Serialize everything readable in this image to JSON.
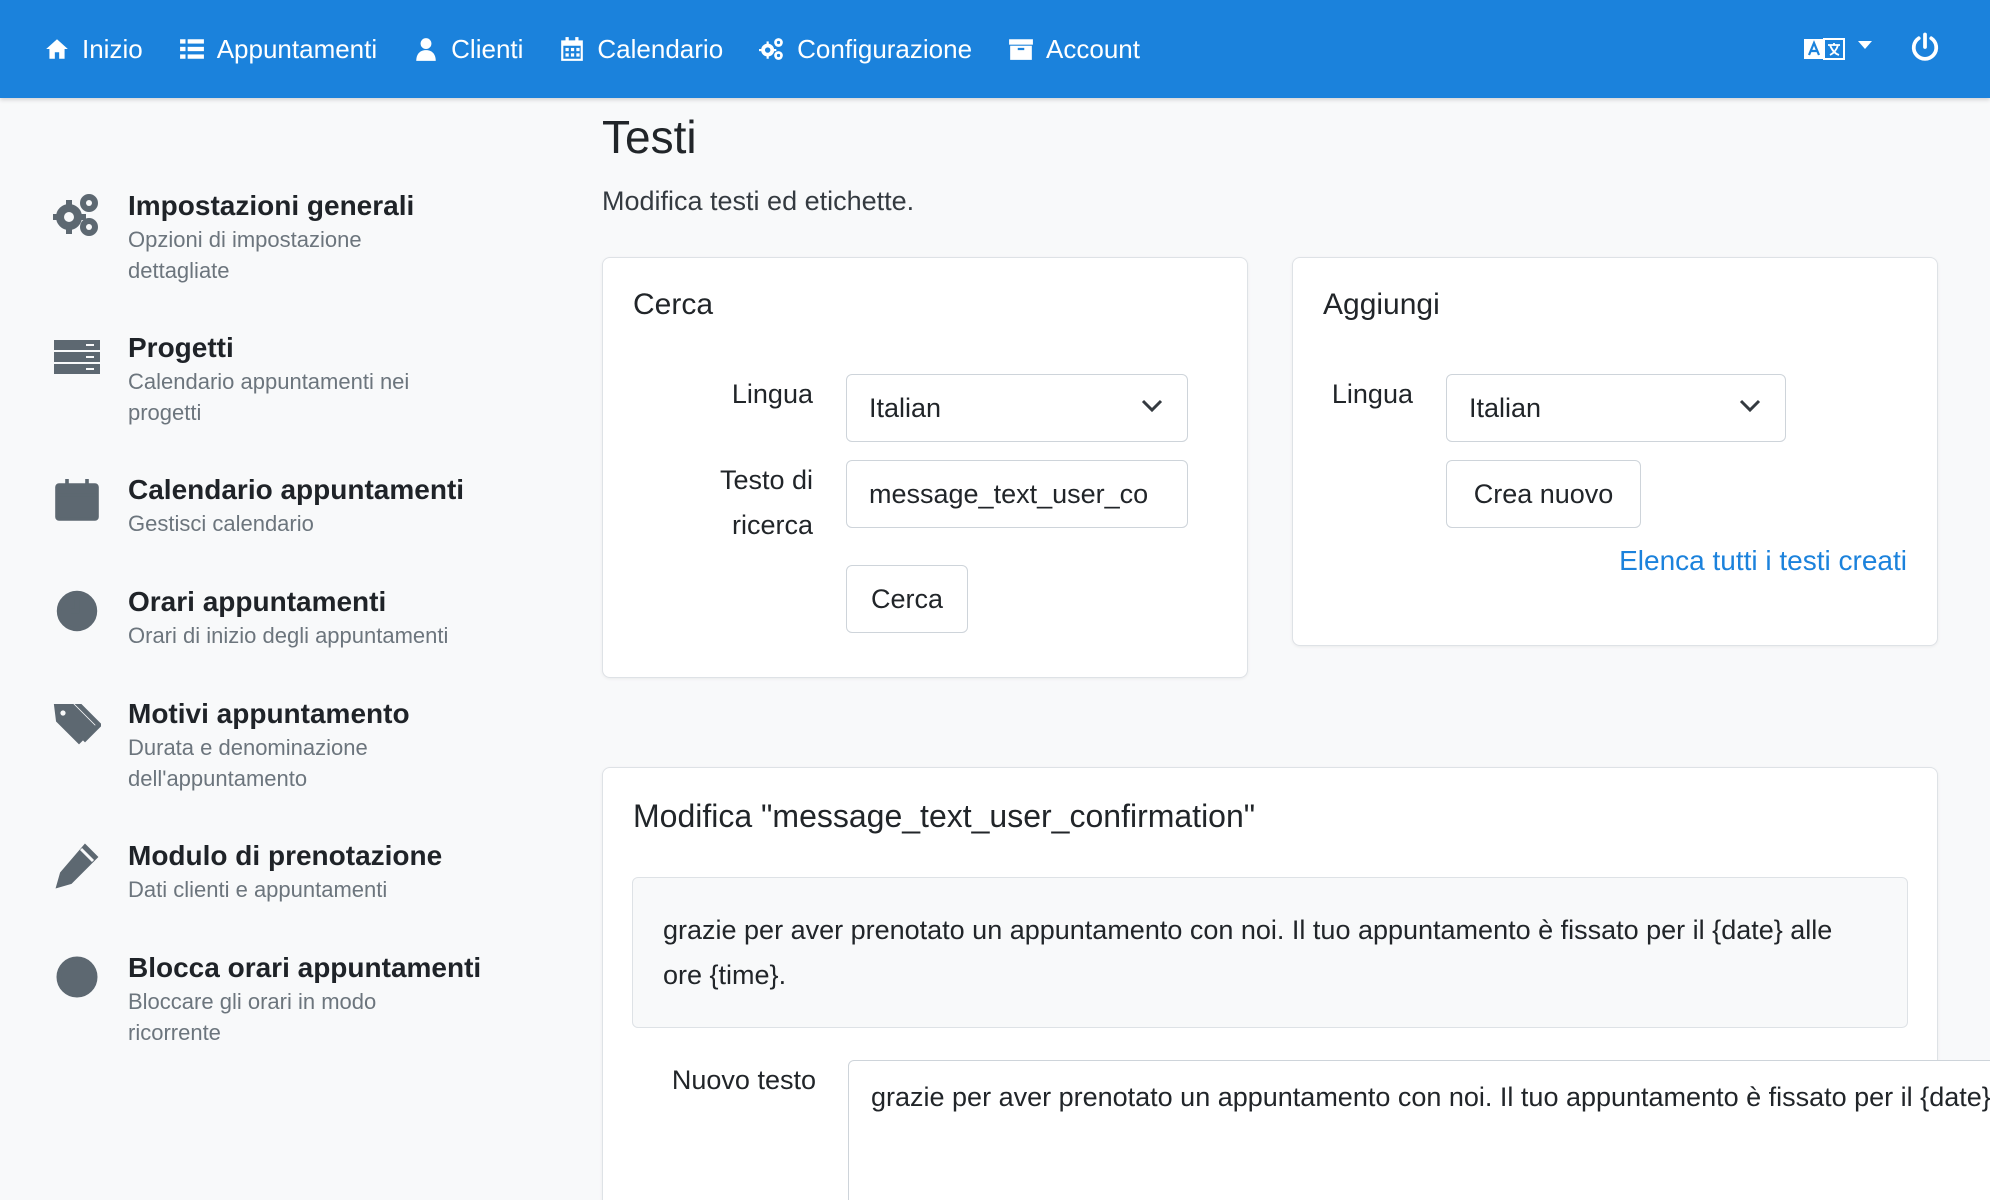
{
  "nav": {
    "items": [
      {
        "label": "Inizio",
        "icon": "home-icon"
      },
      {
        "label": "Appuntamenti",
        "icon": "list-icon"
      },
      {
        "label": "Clienti",
        "icon": "user-icon"
      },
      {
        "label": "Calendario",
        "icon": "calendar-icon"
      },
      {
        "label": "Configurazione",
        "icon": "gears-icon"
      },
      {
        "label": "Account",
        "icon": "archive-icon"
      }
    ],
    "language_icon": "language-icon",
    "power_icon": "power-icon"
  },
  "sidebar": {
    "items": [
      {
        "title": "Impostazioni generali",
        "subtitle": "Opzioni di impostazione dettagliate",
        "icon": "gears-icon"
      },
      {
        "title": "Progetti",
        "subtitle": "Calendario appuntamenti nei progetti",
        "icon": "server-icon"
      },
      {
        "title": "Calendario appuntamenti",
        "subtitle": "Gestisci calendario",
        "icon": "calendar-icon"
      },
      {
        "title": "Orari appuntamenti",
        "subtitle": "Orari di inizio degli appuntamenti",
        "icon": "clock-icon"
      },
      {
        "title": "Motivi appuntamento",
        "subtitle": "Durata e denominazione dell'appuntamento",
        "icon": "tags-icon"
      },
      {
        "title": "Modulo di prenotazione",
        "subtitle": "Dati clienti e appuntamenti",
        "icon": "pencil-icon"
      },
      {
        "title": "Blocca orari appuntamenti",
        "subtitle": "Bloccare gli orari in modo ricorrente",
        "icon": "ban-icon"
      }
    ]
  },
  "page": {
    "title": "Testi",
    "subtitle": "Modifica testi ed etichette."
  },
  "search_card": {
    "title": "Cerca",
    "language_label": "Lingua",
    "language_value": "Italian",
    "search_label": "Testo di ricerca",
    "search_value": "message_text_user_co",
    "button_label": "Cerca"
  },
  "add_card": {
    "title": "Aggiungi",
    "language_label": "Lingua",
    "language_value": "Italian",
    "button_label": "Crea nuovo",
    "list_link": "Elenca tutti i testi creati"
  },
  "edit_card": {
    "title": "Modifica \"message_text_user_confirmation\"",
    "original_text": "grazie per aver prenotato un appuntamento con noi. Il tuo appuntamento è fissato per il {date} alle ore {time}.",
    "new_text_label": "Nuovo testo",
    "new_text_value": "grazie per aver prenotato un appuntamento con noi. Il tuo appuntamento è fissato per il {date} alle ore {time}."
  },
  "colors": {
    "primary": "#1b82dc",
    "link": "#1b82dc",
    "muted": "#6c757d"
  }
}
